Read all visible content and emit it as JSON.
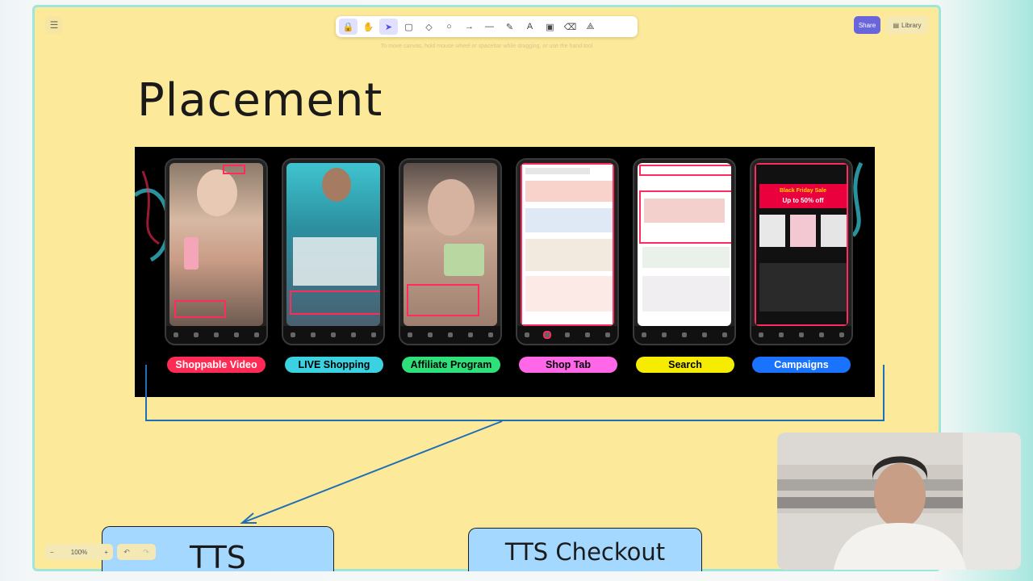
{
  "app": {
    "menu_icon": "hamburger-icon",
    "hint": "To move canvas, hold mouse wheel or spacebar while dragging, or use the hand tool",
    "share_label": "Share",
    "library_label": "Library",
    "zoom": "100%",
    "zoom_out": "−",
    "zoom_in": "+"
  },
  "toolbar": {
    "tools": [
      {
        "name": "lock-icon",
        "glyph": "🔒"
      },
      {
        "name": "hand-icon",
        "glyph": "✋"
      },
      {
        "name": "selection-icon",
        "glyph": "➤"
      },
      {
        "name": "rectangle-icon",
        "glyph": "▢"
      },
      {
        "name": "diamond-icon",
        "glyph": "◇"
      },
      {
        "name": "ellipse-icon",
        "glyph": "○"
      },
      {
        "name": "arrow-icon",
        "glyph": "→"
      },
      {
        "name": "line-icon",
        "glyph": "—"
      },
      {
        "name": "pencil-icon",
        "glyph": "✎"
      },
      {
        "name": "text-icon",
        "glyph": "A"
      },
      {
        "name": "image-icon",
        "glyph": "▣"
      },
      {
        "name": "eraser-icon",
        "glyph": "⌫"
      },
      {
        "name": "more-shapes-icon",
        "glyph": "⟁"
      }
    ]
  },
  "slide": {
    "title": "Placement",
    "placements": [
      {
        "label": "Shoppable Video",
        "bg": "#ff2b55",
        "fg": "#ffffff"
      },
      {
        "label": "LIVE Shopping",
        "bg": "#3ad1e0",
        "fg": "#000000"
      },
      {
        "label": "Affiliate Program",
        "bg": "#2ee07a",
        "fg": "#000000"
      },
      {
        "label": "Shop Tab",
        "bg": "#ff66e8",
        "fg": "#000000"
      },
      {
        "label": "Search",
        "bg": "#f5ec00",
        "fg": "#000000"
      },
      {
        "label": "Campaigns",
        "bg": "#1a73ff",
        "fg": "#ffffff"
      }
    ],
    "campaign_banner": {
      "line1": "Black Friday Sale",
      "line2": "Up to 50% off"
    }
  },
  "boxes": {
    "left": "TTS",
    "right": "TTS Checkout"
  },
  "colors": {
    "canvas": "#fde99a",
    "connector": "#1f6fb8",
    "box_fill": "#a5d8ff"
  }
}
